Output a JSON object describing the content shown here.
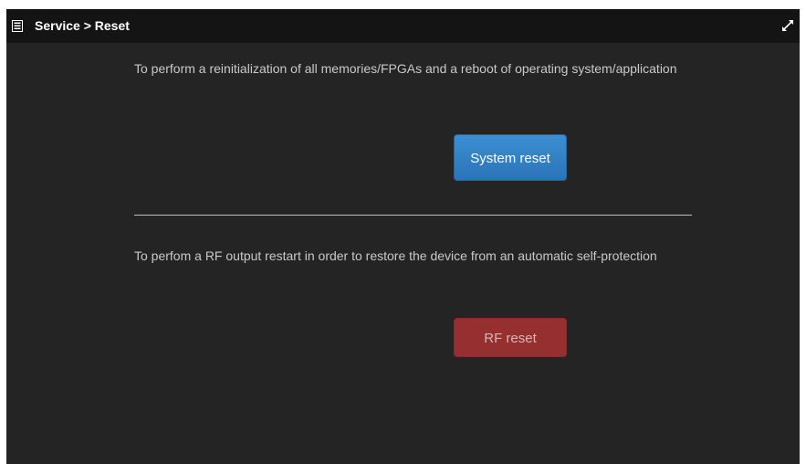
{
  "header": {
    "title": "Service > Reset",
    "menu_icon": "list-icon",
    "collapse_icon": "collapse-arrows-icon"
  },
  "system_section": {
    "description": "To perform a reinitialization of all memories/FPGAs and a reboot of operating system/application",
    "button_label": "System reset",
    "button_color": "#337ab7"
  },
  "rf_section": {
    "description": "To perfom a RF output restart in order to restore the device from an automatic self-protection",
    "button_label": "RF reset",
    "button_color": "#962f2f"
  },
  "colors": {
    "panel_background": "#242424",
    "header_background": "#141414",
    "text": "#c9c9c9"
  }
}
